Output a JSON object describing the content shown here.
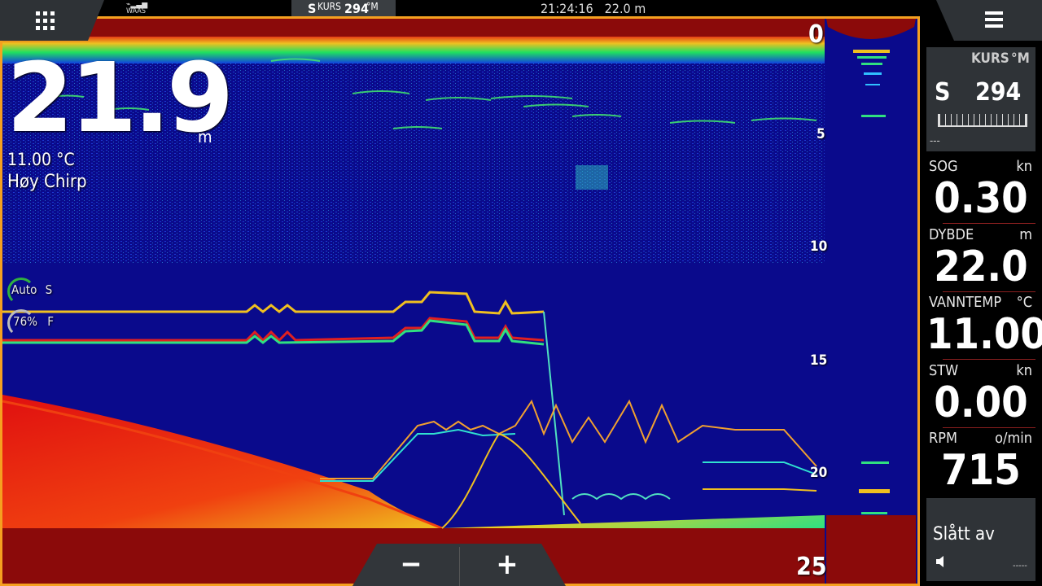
{
  "topbar": {
    "gps_label": "WAAS",
    "heading_ref": "S",
    "heading_label": "KURS",
    "heading_value": "294",
    "heading_unit": "°M",
    "time": "21:24:16",
    "depth_readout": "22.0 m"
  },
  "sonar": {
    "depth_value": "21.9",
    "depth_unit": "m",
    "water_temp": "11.00 °C",
    "frequency_mode": "Høy Chirp",
    "gain_mode": "Auto",
    "gain_tag": "S",
    "color_level": "76%",
    "color_tag": "F",
    "depth_scale": [
      "0",
      "5",
      "10",
      "15",
      "20",
      "25"
    ]
  },
  "zoom": {
    "zoom_out_label": "−",
    "zoom_in_label": "+"
  },
  "sidebar": {
    "heading_box": {
      "label": "KURS",
      "unit": "°M",
      "ref": "S",
      "value": "294",
      "sub": "---"
    },
    "fields": [
      {
        "label": "SOG",
        "unit": "kn",
        "value": "0.30"
      },
      {
        "label": "DYBDE",
        "unit": "m",
        "value": "22.0"
      },
      {
        "label": "VANNTEMP",
        "unit": "°C",
        "value": "11.00"
      },
      {
        "label": "STW",
        "unit": "kn",
        "value": "0.00"
      },
      {
        "label": "RPM",
        "unit": "o/min",
        "value": "715"
      }
    ],
    "alarm": {
      "text": "Slått av",
      "dashes": "-----"
    }
  },
  "colors": {
    "frame": "#f5a020",
    "water": "#0a0a8c",
    "bottom": "#8b0a0a",
    "panel": "#2f3337"
  }
}
